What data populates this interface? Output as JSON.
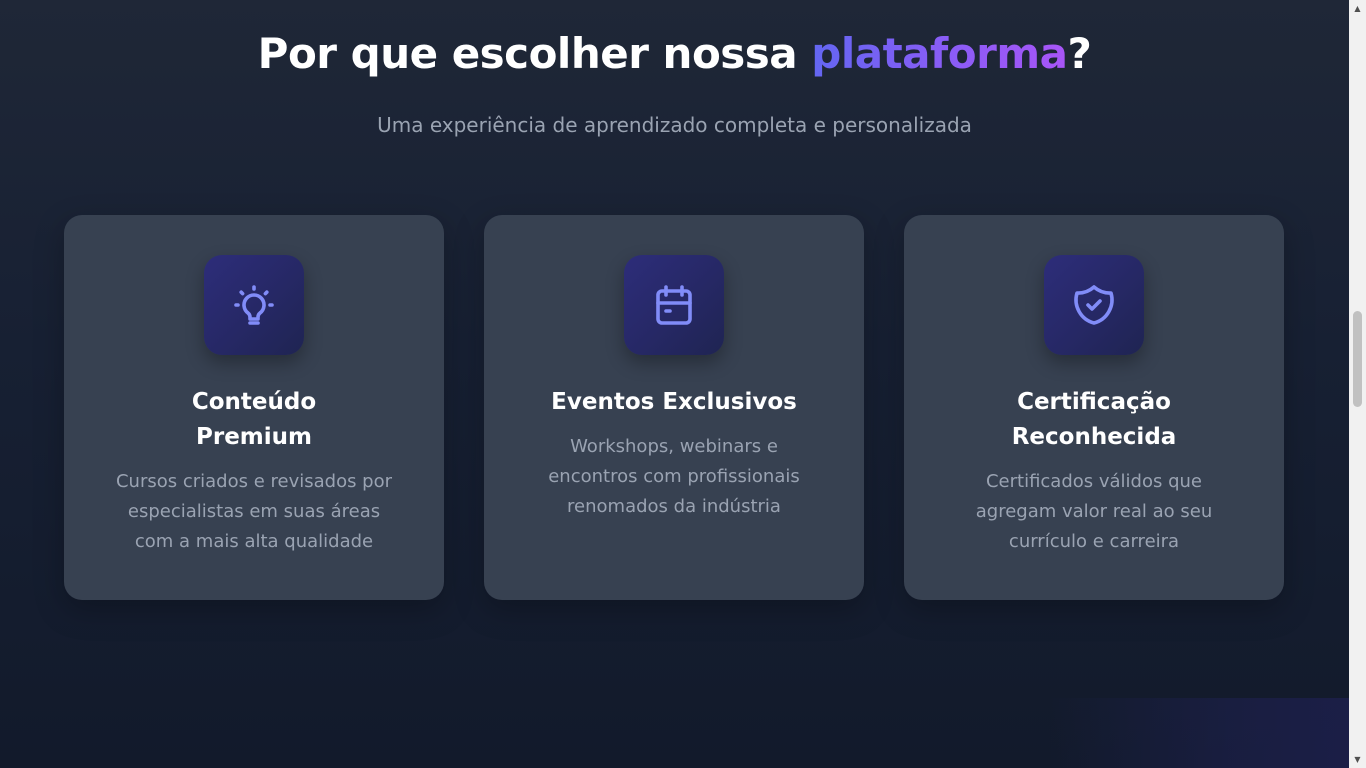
{
  "section": {
    "title_prefix": "Por que escolher nossa ",
    "title_accent": "plataforma",
    "title_suffix": "?",
    "subtitle": "Uma experiência de aprendizado completa e personalizada"
  },
  "colors": {
    "accent_gradient": [
      "#6366f1",
      "#8b5cf6",
      "#a855f7"
    ],
    "card_bg": "#374151",
    "icon_stroke": "#818cf8"
  },
  "features": [
    {
      "icon": "lightbulb-icon",
      "title": "Conteúdo Premium",
      "description": "Cursos criados e revisados por especialistas em suas áreas com a mais alta qualidade"
    },
    {
      "icon": "calendar-icon",
      "title": "Eventos Exclusivos",
      "description": "Workshops, webinars e encontros com profissionais renomados da indústria"
    },
    {
      "icon": "shield-check-icon",
      "title": "Certificação Reconhecida",
      "description": "Certificados válidos que agregam valor real ao seu currículo e carreira"
    }
  ]
}
